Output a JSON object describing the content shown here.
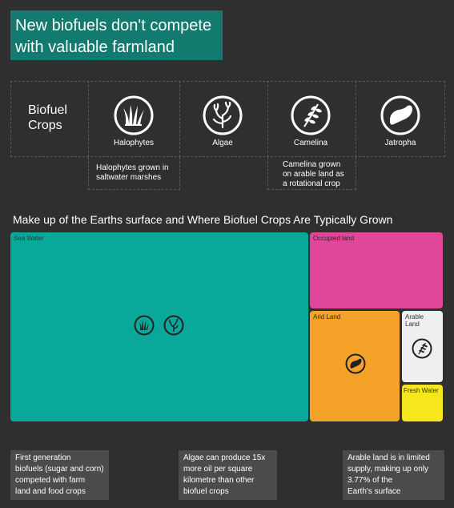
{
  "header": {
    "title_line1": "New biofuels don't compete",
    "title_line2": "with valuable farmland",
    "accent_color": "#127a6e"
  },
  "crops": {
    "label_line1": "Biofuel",
    "label_line2": "Crops",
    "items": [
      {
        "name": "Halophytes",
        "icon": "grass-icon"
      },
      {
        "name": "Algae",
        "icon": "seaweed-icon"
      },
      {
        "name": "Camelina",
        "icon": "camelina-sprig-icon"
      },
      {
        "name": "Jatropha",
        "icon": "seed-icon"
      }
    ],
    "notes": {
      "halophytes_line1": "Halophytes grown in",
      "halophytes_line2": "saltwater marshes",
      "camelina_line1": "Camelina grown",
      "camelina_line2": "on arable land as",
      "camelina_line3": "a rotational crop"
    }
  },
  "treemap": {
    "heading": "Make up of the  Earths surface and Where Biofuel Crops Are Typically Grown",
    "tiles": [
      {
        "label": "Sea Water",
        "color": "#0aa89a",
        "crops": [
          "Halophytes",
          "Algae"
        ]
      },
      {
        "label": "Occupied land",
        "color": "#e0469a",
        "crops": []
      },
      {
        "label": "Arid Land",
        "color": "#f5a228",
        "crops": [
          "Jatropha"
        ]
      },
      {
        "label_line1": "Arable",
        "label_line2": "Land",
        "color": "#efefef",
        "crops": [
          "Camelina"
        ]
      },
      {
        "label": "Fresh Water",
        "color": "#f5e61e",
        "crops": []
      }
    ]
  },
  "footnotes": {
    "first_gen": [
      "First generation",
      "biofuels (sugar and corn)",
      "competed with farm",
      "land and food crops"
    ],
    "algae": [
      "Algae can produce 15x",
      "more oil per square",
      "kilometre than other",
      "biofuel crops"
    ],
    "arable": [
      "Arable land is in limited",
      "supply, making up only",
      "3.77% of the",
      "Earth's surface"
    ]
  }
}
